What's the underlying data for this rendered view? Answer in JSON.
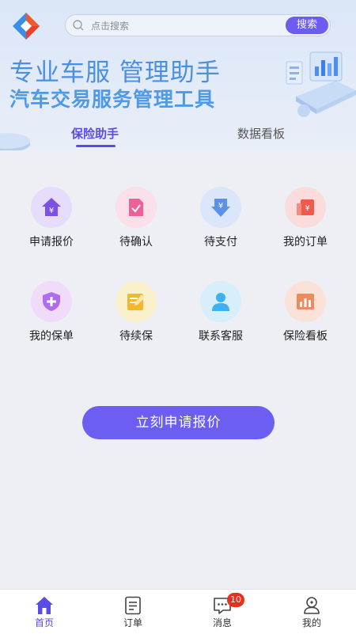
{
  "search": {
    "placeholder": "点击搜索",
    "button_label": "搜索"
  },
  "hero": {
    "title": "专业车服 管理助手",
    "subtitle": "汽车交易服务管理工具"
  },
  "tabs": [
    {
      "label": "保险助手",
      "active": true
    },
    {
      "label": "数据看板",
      "active": false
    }
  ],
  "grid": [
    {
      "label": "申请报价",
      "icon": "home-yen-icon",
      "color": "#7b4fe8"
    },
    {
      "label": "待确认",
      "icon": "document-check-icon",
      "color": "#ef5f9a"
    },
    {
      "label": "待支付",
      "icon": "yen-down-arrow-icon",
      "color": "#5b8ff0"
    },
    {
      "label": "我的订单",
      "icon": "yen-receipt-icon",
      "color": "#ef5a4e"
    },
    {
      "label": "我的保单",
      "icon": "shield-plus-icon",
      "color": "#b06cf0"
    },
    {
      "label": "待续保",
      "icon": "note-edit-icon",
      "color": "#f3b72d"
    },
    {
      "label": "联系客服",
      "icon": "person-icon",
      "color": "#3fb0f0"
    },
    {
      "label": "保险看板",
      "icon": "bar-chart-icon",
      "color": "#f08a5e"
    }
  ],
  "cta": {
    "label": "立刻申请报价"
  },
  "tabbar": [
    {
      "label": "首页",
      "icon": "home-icon",
      "active": true
    },
    {
      "label": "订单",
      "icon": "order-list-icon",
      "active": false
    },
    {
      "label": "消息",
      "icon": "message-icon",
      "active": false,
      "badge": "10"
    },
    {
      "label": "我的",
      "icon": "profile-icon",
      "active": false
    }
  ],
  "colors": {
    "accent": "#6b5ef0",
    "badge": "#e8301c",
    "hero_text": "#4b90e0"
  }
}
